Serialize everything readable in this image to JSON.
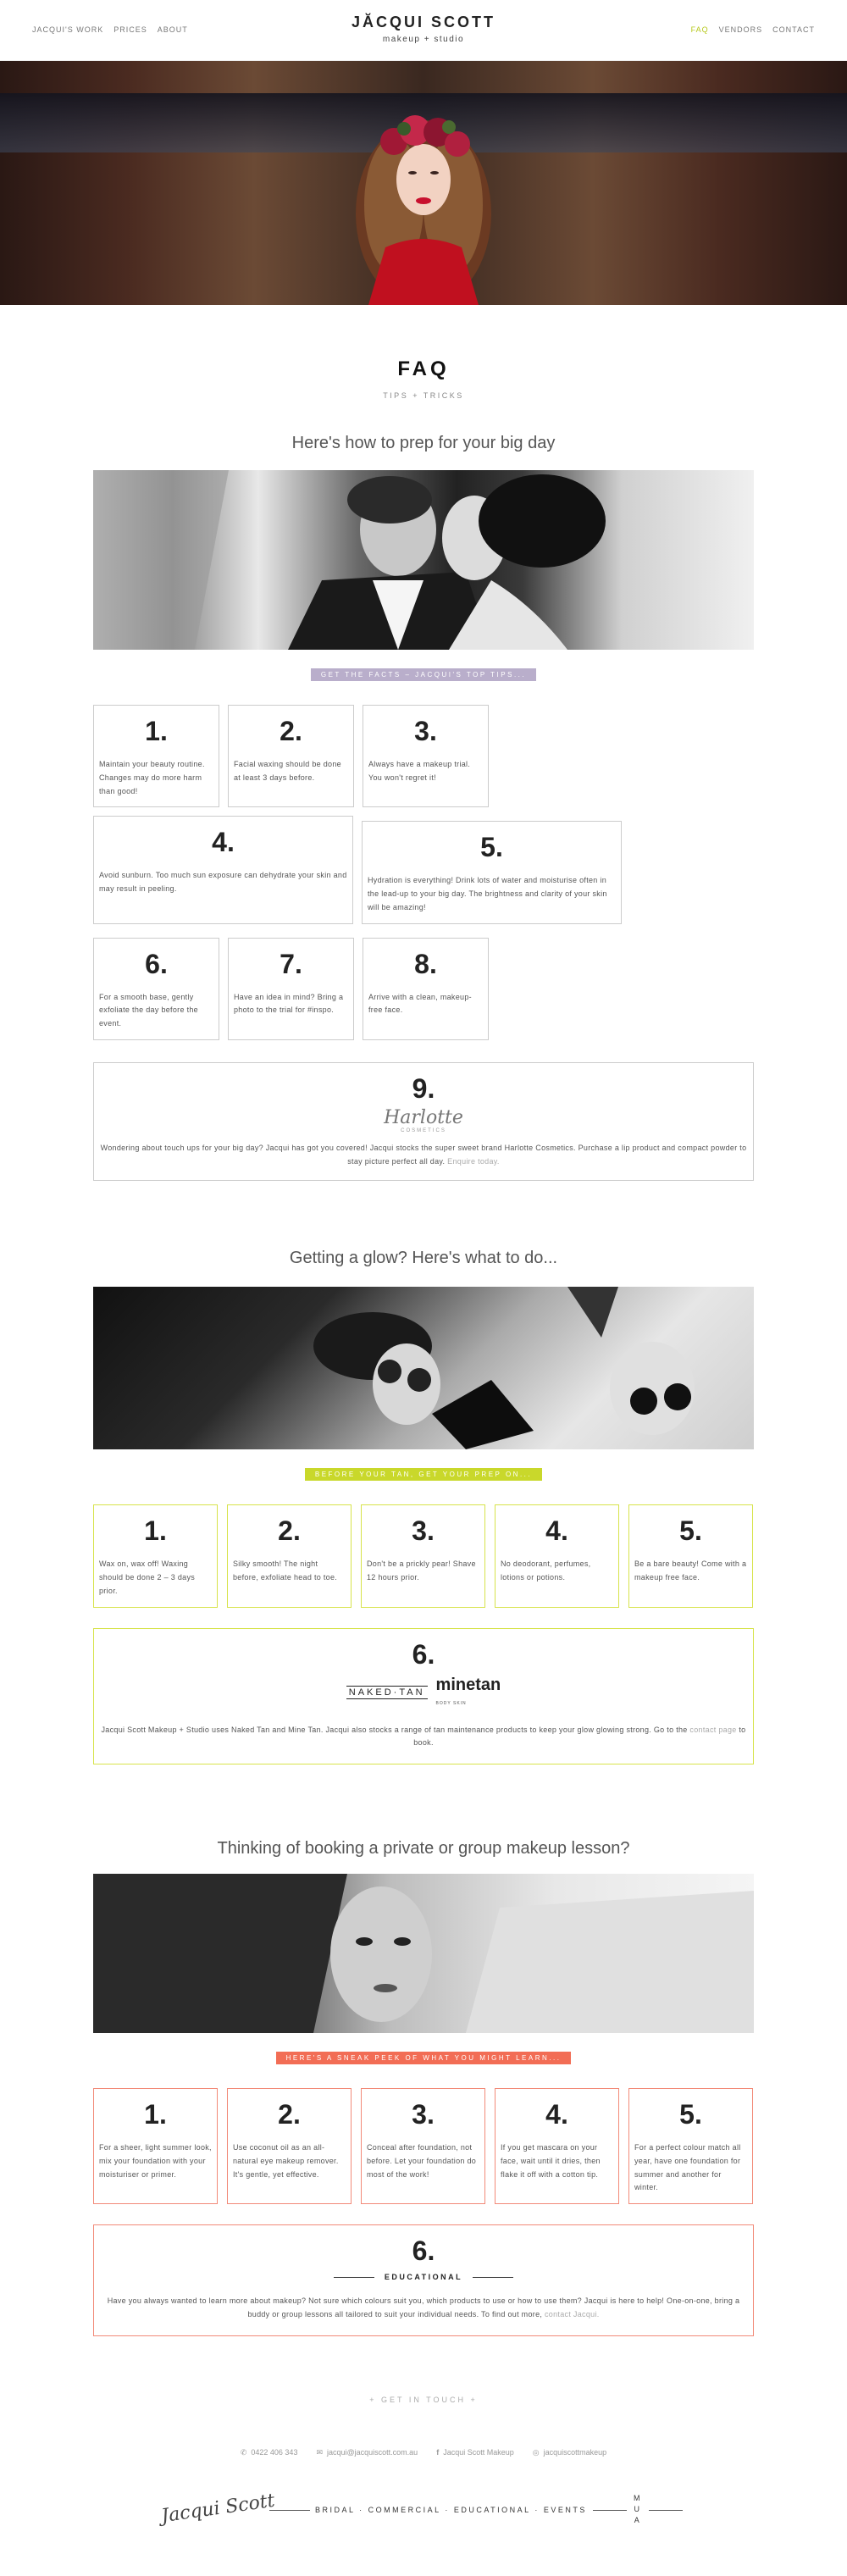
{
  "nav": {
    "left": [
      "JACQUI'S WORK",
      "PRICES",
      "ABOUT"
    ],
    "right": [
      "FAQ",
      "VENDORS",
      "CONTACT"
    ],
    "active": "FAQ"
  },
  "brand": {
    "name": "JĂCQUI SCOTT",
    "sub": "makeup + studio"
  },
  "faq": {
    "title": "FAQ",
    "subtitle": "TIPS + TRICKS"
  },
  "section1": {
    "heading": "Here's how to prep for your big day",
    "banner": "GET THE FACTS – JACQUI'S TOP TIPS...",
    "banner_color": "#b9aecb",
    "tips": [
      {
        "num": "1.",
        "text": "Maintain your beauty routine. Changes may do more harm than good!"
      },
      {
        "num": "2.",
        "text": "Facial waxing should be done at least 3 days before."
      },
      {
        "num": "3.",
        "text": "Always have a makeup trial. You won't regret it!"
      },
      {
        "num": "4.",
        "text": "Avoid sunburn. Too much sun exposure can dehydrate your skin and may result in peeling."
      },
      {
        "num": "5.",
        "text": "Hydration is everything! Drink lots of water and moisturise often in the lead-up to your big day. The brightness and clarity of your skin will be amazing!"
      },
      {
        "num": "6.",
        "text": "For a smooth base, gently exfoliate the day before the event."
      },
      {
        "num": "7.",
        "text": "Have an idea in mind? Bring a photo to the trial for #inspo."
      },
      {
        "num": "8.",
        "text": "Arrive with a clean, makeup-free face."
      }
    ],
    "tip9": {
      "num": "9.",
      "logo": "Harlotte",
      "logo_sub": "COSMETICS",
      "text": "Wondering about touch ups for your big day? Jacqui has got you covered! Jacqui stocks the super sweet brand Harlotte Cosmetics. Purchase a lip product and compact powder to stay picture perfect all day.",
      "link": "Enquire today."
    }
  },
  "section2": {
    "heading": "Getting a glow? Here's what to do...",
    "banner": "BEFORE YOUR TAN, GET YOUR PREP ON...",
    "banner_color": "#c9d82b",
    "tips": [
      {
        "num": "1.",
        "text": "Wax on, wax off! Waxing should be done 2 – 3 days prior."
      },
      {
        "num": "2.",
        "text": "Silky smooth! The night before, exfoliate head to toe."
      },
      {
        "num": "3.",
        "text": "Don't be a prickly pear! Shave 12 hours prior."
      },
      {
        "num": "4.",
        "text": "No deodorant, perfumes, lotions or potions."
      },
      {
        "num": "5.",
        "text": "Be a bare beauty! Come with a makeup free face."
      }
    ],
    "tip6": {
      "num": "6.",
      "logo1": "NAKED·TAN",
      "logo2": "minetan",
      "logo2_sub": "BODY SKIN",
      "text": "Jacqui Scott Makeup + Studio uses Naked Tan and Mine Tan. Jacqui also stocks a range of tan maintenance products to keep your glow glowing strong. Go to the",
      "link": "contact page",
      "text_after": "to book."
    }
  },
  "section3": {
    "heading": "Thinking of booking a private or group makeup lesson?",
    "banner": "HERE'S A SNEAK PEEK OF WHAT YOU MIGHT LEARN...",
    "banner_color": "#f26d55",
    "tips": [
      {
        "num": "1.",
        "text": "For a sheer, light summer look, mix your foundation with your moisturiser or primer."
      },
      {
        "num": "2.",
        "text": "Use coconut oil as an all-natural eye makeup remover. It's gentle, yet effective."
      },
      {
        "num": "3.",
        "text": "Conceal after foundation, not before. Let your foundation do most of the work!"
      },
      {
        "num": "4.",
        "text": "If you get mascara on your face, wait until it dries, then flake it off with a cotton tip."
      },
      {
        "num": "5.",
        "text": "For a perfect colour match all year, have one foundation for summer and another for winter."
      }
    ],
    "tip6": {
      "num": "6.",
      "label": "EDUCATIONAL",
      "text": "Have you always wanted to learn more about makeup? Not sure which colours suit you, which products to use or how to use them? Jacqui is here to help! One-on-one, bring a buddy or group lessons all tailored to suit your individual needs. To find out more,",
      "link": "contact Jacqui."
    }
  },
  "footer": {
    "touch": "+ GET IN TOUCH +",
    "phone": "0422 406 343",
    "email": "jacqui@jacquiscott.com.au",
    "facebook": "Jacqui Scott Makeup",
    "instagram": "jacquiscottmakeup",
    "signature": "Jacqui Scott",
    "services": "BRIDAL · COMMERCIAL · EDUCATIONAL · EVENTS",
    "mua": [
      "M",
      "U",
      "A"
    ]
  }
}
